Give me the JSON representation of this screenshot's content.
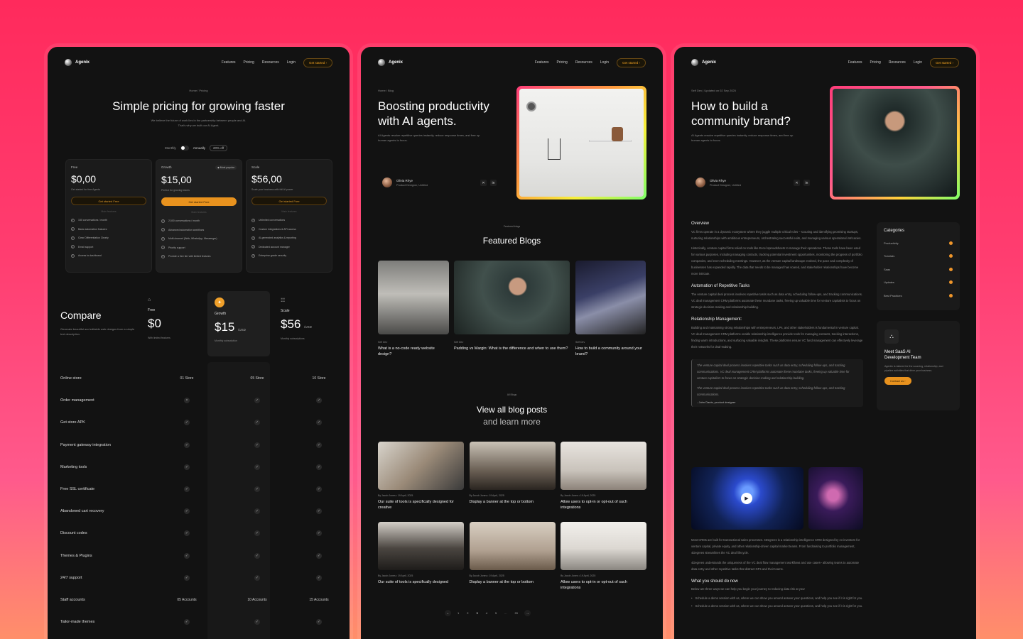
{
  "brand": "Agenix",
  "nav": {
    "links": [
      "Features",
      "Pricing",
      "Resources",
      "Login"
    ],
    "cta": "Get started"
  },
  "pricing_page": {
    "breadcrumb": "Home / Pricing",
    "title": "Simple pricing for growing faster",
    "subtitle": "We believe the future of work lies in the partnership between people and AI. That's why we built our AI Agent.",
    "toggle": {
      "monthly": "Monthly",
      "annually": "Annually",
      "badge": "20% off"
    },
    "plans": [
      {
        "name": "Free",
        "price": "$0,00",
        "desc": "Get started for free Agents",
        "cta": "Get started Free",
        "sep": "Main features",
        "tag": "",
        "features": [
          "150 conversations / month",
          "Basic automation features",
          "Clear Differentiation Clearly",
          "Email support",
          "Access to dashboard"
        ]
      },
      {
        "name": "Growth",
        "price": "$15,00",
        "desc": "Perfect for growing teams",
        "cta": "Get started Free",
        "sep": "Main features",
        "tag": "Most popular",
        "features": [
          "2,500 conversations / month",
          "Advanced automation workflows",
          "Multi-channel (Web, WhatsApp, Messenger)",
          "Priority support",
          "Provide a free tier with limited features"
        ]
      },
      {
        "name": "Scale",
        "price": "$56,00",
        "desc": "Scale your business with full AI power",
        "cta": "Get started Free",
        "sep": "Main features",
        "tag": "",
        "features": [
          "Unlimited conversations",
          "Custom integrations & API access",
          "AI-generated analytics & reporting",
          "Dedicated account manager",
          "Enterprise-grade security"
        ]
      }
    ],
    "compare": {
      "title": "Compare",
      "desc": "Generate beautiful and editable web designs from a simple text description.",
      "cols": [
        {
          "name": "Free",
          "price": "$0",
          "unit": "",
          "note": "With limited features"
        },
        {
          "name": "Growth",
          "price": "$15",
          "unit": "/USD",
          "note": "Monthly subscription"
        },
        {
          "name": "Scale",
          "price": "$56",
          "unit": "/USD",
          "note": "Monthly subscriptions"
        }
      ],
      "rows": [
        {
          "label": "Online store",
          "vals": [
            "01 Store",
            "05 Store",
            "10 Store"
          ]
        },
        {
          "label": "Order management",
          "vals": [
            "x",
            "check",
            "check"
          ]
        },
        {
          "label": "Get store APK",
          "vals": [
            "check",
            "check",
            "check"
          ]
        },
        {
          "label": "Payment gateway integration",
          "vals": [
            "check",
            "check",
            "check"
          ]
        },
        {
          "label": "Marketing tools",
          "vals": [
            "check",
            "check",
            "check"
          ]
        },
        {
          "label": "Free SSL certificate",
          "vals": [
            "check",
            "check",
            "check"
          ]
        },
        {
          "label": "Abandoned cart recovery",
          "vals": [
            "check",
            "check",
            "check"
          ]
        },
        {
          "label": "Discount codes",
          "vals": [
            "check",
            "check",
            "check"
          ]
        },
        {
          "label": "Themes & Plugins",
          "vals": [
            "check",
            "check",
            "check"
          ]
        },
        {
          "label": "24/7 support",
          "vals": [
            "check",
            "check",
            "check"
          ]
        },
        {
          "label": "Staff accounts",
          "vals": [
            "05 Accounts",
            "10 Accounts",
            "15 Accounts"
          ]
        },
        {
          "label": "Tailor-made themes",
          "vals": [
            "check",
            "check",
            "check"
          ]
        }
      ]
    }
  },
  "blog_page": {
    "breadcrumb": "Home / Blog",
    "title_l1": "Boosting productivity",
    "title_l2": "with AI agents.",
    "desc": "AI Agents resolve repetitive queries instantly, reduce response times, and free up human agents to focus.",
    "author": {
      "name": "Olivia Rhye",
      "role": "Product Designer, Untitled"
    },
    "featured_eyebrow": "Featured blogs",
    "featured_title": "Featured Blogs",
    "featured": [
      {
        "cat": "Self Dev",
        "title": "What is a no-code ready website design?"
      },
      {
        "cat": "Self Dev",
        "title": "Padding vs Margin: What is the difference and when to use them?"
      },
      {
        "cat": "Self Dev",
        "title": "How to build a community around your brand?"
      }
    ],
    "all_eyebrow": "All Blogs",
    "all_title_l1": "View all blog posts",
    "all_title_l2": "and learn more",
    "posts": [
      {
        "meta": "By Jacob Jones  •  19 April, 2025",
        "title": "Our suite of tools is specifically designed for creative"
      },
      {
        "meta": "By Jacob Jones  •  19 April, 2025",
        "title": "Display a banner at the top or bottom"
      },
      {
        "meta": "By Jacob Jones  •  19 April, 2025",
        "title": "Allow users to opt-in or opt-out of such integrations"
      },
      {
        "meta": "By Jacob Jones  •  19 April, 2025",
        "title": "Our suite of tools is specifically designed"
      },
      {
        "meta": "By Jacob Jones  •  19 April, 2025",
        "title": "Display a banner at the top or bottom"
      },
      {
        "meta": "By Jacob Jones  •  19 April, 2025",
        "title": "Allow users to opt-in or opt-out of such integrations"
      }
    ],
    "pagination": [
      "1",
      "2",
      "3",
      "4",
      "5",
      "...",
      "20"
    ]
  },
  "article_page": {
    "breadcrumb": "Self Dev | Updated on 02 Sep 2025",
    "title_l1": "How to build a",
    "title_l2": "community brand?",
    "desc": "AI Agents resolve repetitive queries instantly, reduce response times, and free up human agents to focus.",
    "author": {
      "name": "Olivia Rhye",
      "role": "Product Designer, Untitled"
    },
    "overview_h": "Overview",
    "overview_p1": "VC firms operate in a dynamic ecosystem where they juggle multiple critical roles – scouting and identifying promising startups, nurturing relationships with ambitious entrepreneurs, orchestrating successful exits, and managing various operational intricacies.",
    "overview_p2": "Historically, venture capital firms relied on tools like Excel spreadsheets to manage their operations. These tools have been used for various purposes, including managing contacts, tracking potential investment opportunities, monitoring the progress of portfolio companies, and even scheduling meetings. However, as the venture capital landscape evolved, the pace and complexity of businesses has expanded rapidly. The data that needs to be managed has soared, and stakeholder relationships have become more intricate.",
    "auto_h": "Automation of Repetitive Tasks",
    "auto_p": "The venture capital deal process involves repetitive tasks such as data entry, scheduling follow-ups, and tracking communications. VC deal management CRM platforms automate these mundane tasks, freeing up valuable time for venture capitalists to focus on strategic decision-making and relationship-building.",
    "rel_h": "Relationship Management:",
    "rel_p": "Building and maintaining strong relationships with entrepreneurs, LPs, and other stakeholders is fundamental in venture capital. VC deal management CRM platforms enable relationship intelligence provide tools for managing contacts, tracking interactions, finding warm introductions, and surfacing valuable insights. These platforms ensure VC fund management can effectively leverage their networks for deal-making.",
    "quote_p1": "The venture capital deal process involves repetitive tasks such as data entry, scheduling follow-ups, and tracking communications. VC deal management CRM platforms automate these mundane tasks, freeing up valuable time for venture capitalists to focus on strategic decision-making and relationship-building.",
    "quote_p2": "The venture capital deal process involves repetitive tasks such as data entry, scheduling follow-ups, and tracking communications.",
    "quote_author": "- John Danis, product designer",
    "body_p1": "Most CRMs are built for transactional sales processes. 4Degrees is a relationship intelligence CRM designed by ex-investors for venture capital, private equity, and other relationship-driven capital market teams. From fundraising to portfolio management, 4Degrees streamlines the VC deal lifecycle.",
    "body_p2": "4Degrees understands the uniqueness of the VC deal flow management workflows and use cases– allowing teams to automate data entry and other repetitive tasks that distract GPs and their teams.",
    "now_h": "What you should do now",
    "now_p": "Below are three ways we can help you begin your journey to reducing data risk at your",
    "bullets": [
      "Schedule a demo session with us, where we can show you around answer your questions, and help you see if it is right for you.",
      "Schedule a demo session with us, where we can show you around answer your questions, and help you see if it is right for you."
    ],
    "categories_h": "Categories",
    "categories": [
      "Productivity",
      "Tutorials",
      "Saas",
      "Updates",
      "Best Practices"
    ],
    "promo": {
      "title_l1": "Meet SaaS AI",
      "title_l2": "Development Team",
      "desc": "Agentix is tailored for the sourcing, relationship, and pipeline activities that drive your business.",
      "cta": "Contact us"
    }
  }
}
